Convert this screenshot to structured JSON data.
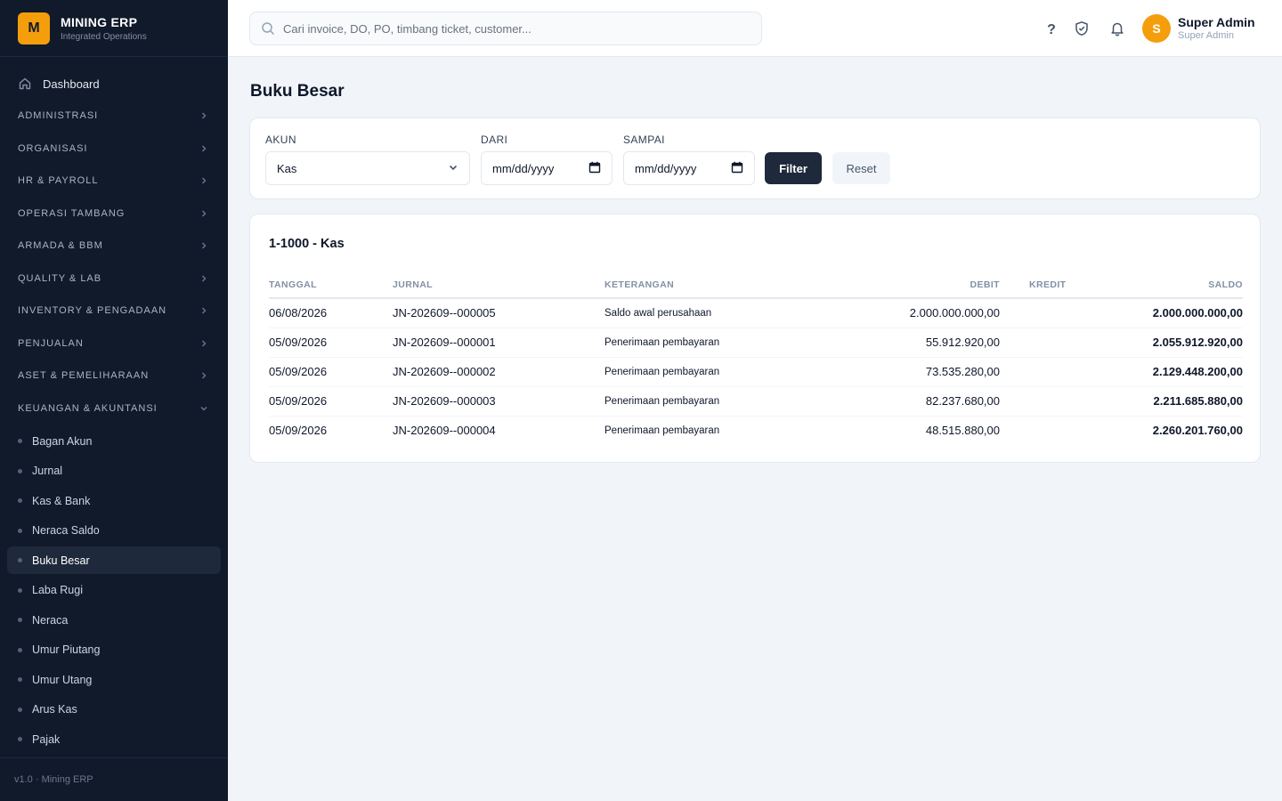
{
  "brand": {
    "logo": "M",
    "name": "MINING ERP",
    "subtitle": "Integrated Operations"
  },
  "sidebar": {
    "dashboard": "Dashboard",
    "groups": [
      "ADMINISTRASI",
      "ORGANISASI",
      "HR & PAYROLL",
      "OPERASI TAMBANG",
      "ARMADA & BBM",
      "QUALITY & LAB",
      "INVENTORY & PENGADAAN",
      "PENJUALAN",
      "ASET & PEMELIHARAAN",
      "KEUANGAN & AKUNTANSI"
    ],
    "expanded_group": "KEUANGAN & AKUNTANSI",
    "sub_items": [
      "Bagan Akun",
      "Jurnal",
      "Kas & Bank",
      "Neraca Saldo",
      "Buku Besar",
      "Laba Rugi",
      "Neraca",
      "Umur Piutang",
      "Umur Utang",
      "Arus Kas",
      "Pajak"
    ],
    "active_item": "Buku Besar",
    "footer": "v1.0 · Mining ERP"
  },
  "header": {
    "search_placeholder": "Cari invoice, DO, PO, timbang ticket, customer...",
    "icons": [
      "help-icon",
      "shield-check-icon",
      "bell-icon"
    ],
    "avatar_initial": "S",
    "user_name": "Super Admin",
    "user_role": "Super Admin"
  },
  "page": {
    "title": "Buku Besar"
  },
  "filters": {
    "akun_label": "AKUN",
    "akun_value": "Kas",
    "dari_label": "DARI",
    "dari_value": "mm/dd/yyyy",
    "sampai_label": "SAMPAI",
    "sampai_value": "mm/dd/yyyy",
    "filter_button": "Filter",
    "reset_button": "Reset"
  },
  "ledger": {
    "title": "1-1000 - Kas",
    "columns": [
      "TANGGAL",
      "JURNAL",
      "KETERANGAN",
      "DEBIT",
      "KREDIT",
      "SALDO"
    ],
    "rows": [
      {
        "tanggal": "06/08/2026",
        "jurnal": "JN-202609--000005",
        "keterangan": "Saldo awal perusahaan",
        "debit": "2.000.000.000,00",
        "kredit": "",
        "saldo": "2.000.000.000,00"
      },
      {
        "tanggal": "05/09/2026",
        "jurnal": "JN-202609--000001",
        "keterangan": "Penerimaan pembayaran",
        "debit": "55.912.920,00",
        "kredit": "",
        "saldo": "2.055.912.920,00"
      },
      {
        "tanggal": "05/09/2026",
        "jurnal": "JN-202609--000002",
        "keterangan": "Penerimaan pembayaran",
        "debit": "73.535.280,00",
        "kredit": "",
        "saldo": "2.129.448.200,00"
      },
      {
        "tanggal": "05/09/2026",
        "jurnal": "JN-202609--000003",
        "keterangan": "Penerimaan pembayaran",
        "debit": "82.237.680,00",
        "kredit": "",
        "saldo": "2.211.685.880,00"
      },
      {
        "tanggal": "05/09/2026",
        "jurnal": "JN-202609--000004",
        "keterangan": "Penerimaan pembayaran",
        "debit": "48.515.880,00",
        "kredit": "",
        "saldo": "2.260.201.760,00"
      }
    ]
  },
  "colors": {
    "sidebar_bg": "#111a2b",
    "accent": "#f59e0b",
    "primary_button": "#1e293b",
    "page_bg": "#f1f5f9"
  }
}
